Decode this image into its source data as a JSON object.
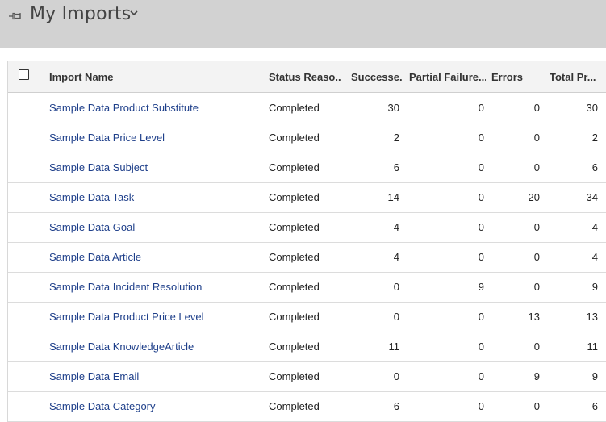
{
  "header": {
    "title": "My Imports",
    "pin_icon": "pin-icon",
    "dropdown_icon": "chevron-down-icon"
  },
  "grid": {
    "columns": {
      "name": "Import Name",
      "status": "Status Reaso...",
      "successes": "Successe...",
      "partial": "Partial Failure...",
      "errors": "Errors",
      "total": "Total Pr..."
    },
    "rows": [
      {
        "name": "Sample Data Product Substitute",
        "status": "Completed",
        "successes": "30",
        "partial": "0",
        "errors": "0",
        "total": "30"
      },
      {
        "name": "Sample Data Price Level",
        "status": "Completed",
        "successes": "2",
        "partial": "0",
        "errors": "0",
        "total": "2"
      },
      {
        "name": "Sample Data Subject",
        "status": "Completed",
        "successes": "6",
        "partial": "0",
        "errors": "0",
        "total": "6"
      },
      {
        "name": "Sample Data Task",
        "status": "Completed",
        "successes": "14",
        "partial": "0",
        "errors": "20",
        "total": "34"
      },
      {
        "name": "Sample Data Goal",
        "status": "Completed",
        "successes": "4",
        "partial": "0",
        "errors": "0",
        "total": "4"
      },
      {
        "name": "Sample Data Article",
        "status": "Completed",
        "successes": "4",
        "partial": "0",
        "errors": "0",
        "total": "4"
      },
      {
        "name": "Sample Data Incident Resolution",
        "status": "Completed",
        "successes": "0",
        "partial": "9",
        "errors": "0",
        "total": "9"
      },
      {
        "name": "Sample Data Product Price Level",
        "status": "Completed",
        "successes": "0",
        "partial": "0",
        "errors": "13",
        "total": "13"
      },
      {
        "name": "Sample Data KnowledgeArticle",
        "status": "Completed",
        "successes": "11",
        "partial": "0",
        "errors": "0",
        "total": "11"
      },
      {
        "name": "Sample Data Email",
        "status": "Completed",
        "successes": "0",
        "partial": "0",
        "errors": "9",
        "total": "9"
      },
      {
        "name": "Sample Data Category",
        "status": "Completed",
        "successes": "6",
        "partial": "0",
        "errors": "0",
        "total": "6"
      }
    ]
  },
  "colors": {
    "topbar": "#d2d2d2",
    "link": "#1e3f8a",
    "header_bg": "#f3f3f3"
  }
}
